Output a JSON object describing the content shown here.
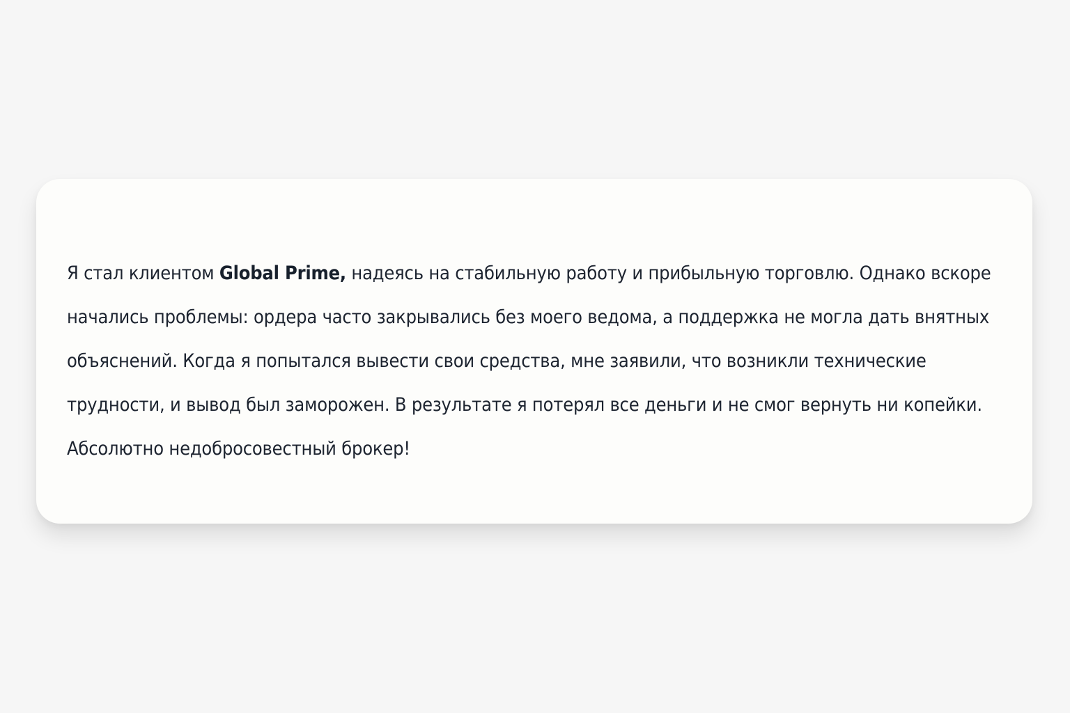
{
  "review": {
    "line1_before": "Я стал клиентом ",
    "brand": "Global Prime,",
    "line1_after": " надеясь на стабильную работу и прибыльную торговлю. Однако вскоре",
    "line2": "начались проблемы: ордера часто закрывались без моего ведома, а поддержка не могла дать внятных",
    "line3": "объяснений. Когда я попытался вывести свои средства, мне заявили, что возникли технические",
    "line4": "трудности, и вывод был заморожен. В результате я потерял все деньги и не смог вернуть ни копейки.",
    "line5": "Абсолютно недобросовестный брокер!"
  }
}
